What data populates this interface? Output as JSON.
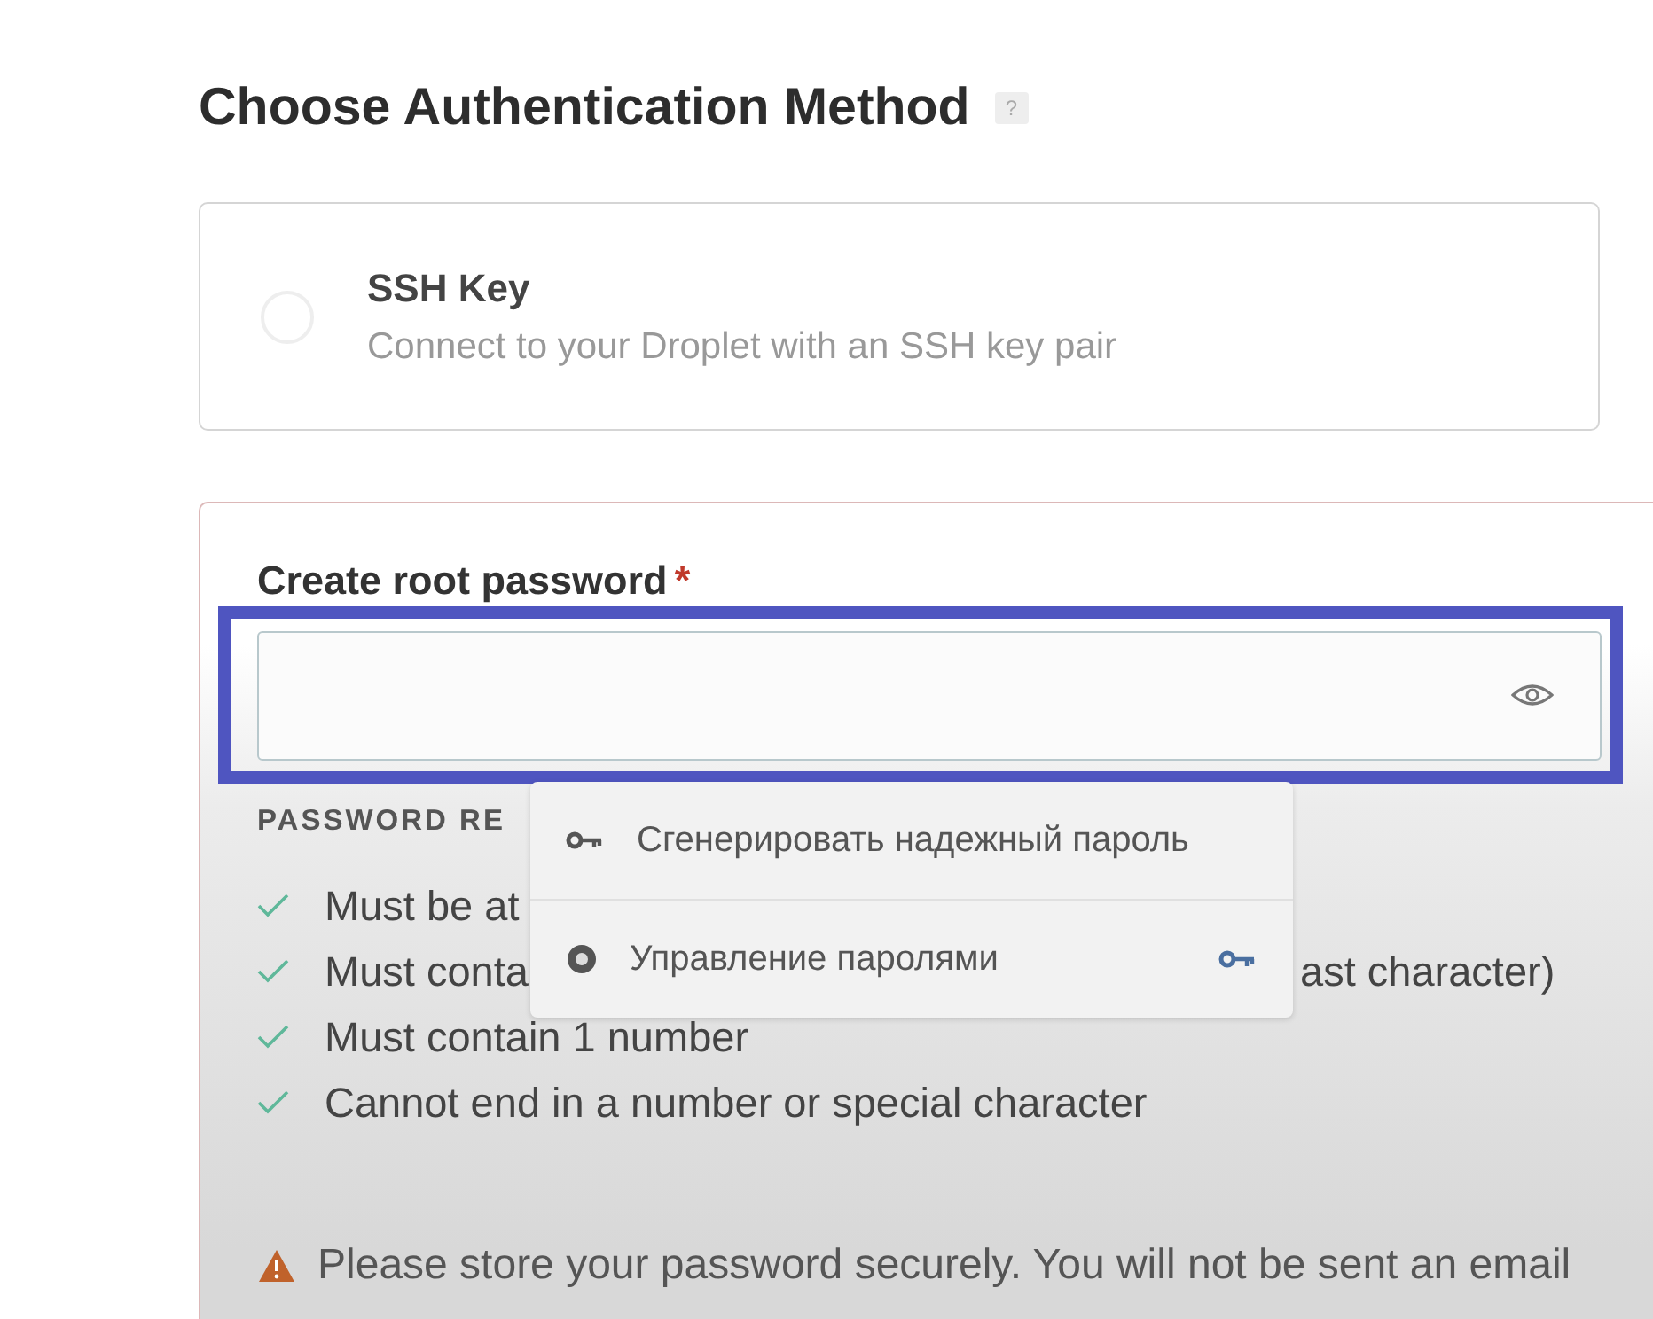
{
  "heading": {
    "title": "Choose Authentication Method",
    "help": "?"
  },
  "options": [
    {
      "title": "SSH Key",
      "description": "Connect to your Droplet with an SSH key pair",
      "selected": false
    }
  ],
  "password": {
    "label": "Create root password",
    "required": "*",
    "focused": true,
    "requirements_title": "PASSWORD RE",
    "requirements": [
      {
        "text": "Must be at",
        "met": true
      },
      {
        "text": "Must conta",
        "tail": "ast character)",
        "met": true
      },
      {
        "text": "Must contain 1 number",
        "met": true
      },
      {
        "text": "Cannot end in a number or special character",
        "met": true
      }
    ],
    "warning": "Please store your password securely. You will not be sent an email"
  },
  "autofill_menu": [
    {
      "kind": "generate",
      "label": "Сгенерировать надежный пароль"
    },
    {
      "kind": "manage",
      "label": "Управление паролями"
    }
  ]
}
